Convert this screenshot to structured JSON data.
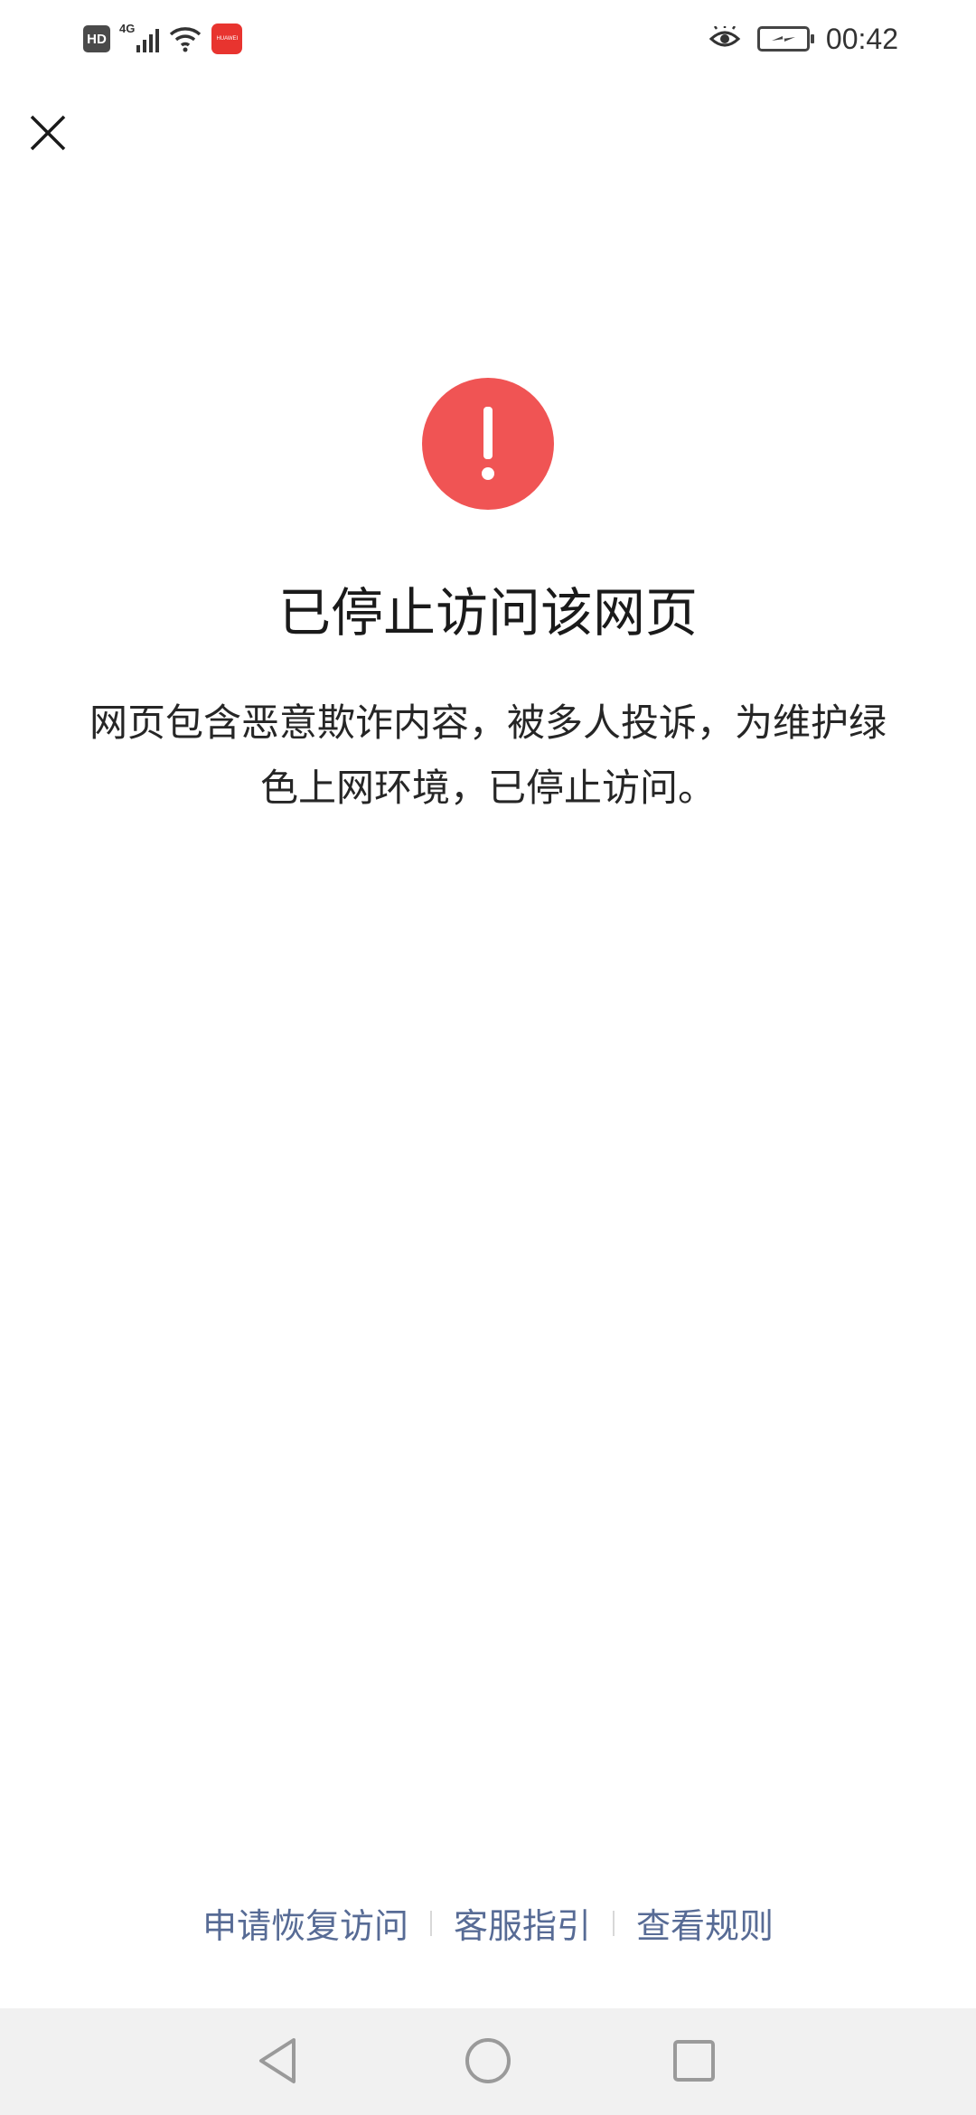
{
  "status_bar": {
    "hd_label": "HD",
    "network_label": "4G",
    "app_icon_label": "HUAWEI",
    "time": "00:42",
    "icons": [
      "hd-icon",
      "signal-icon",
      "wifi-icon",
      "app-store-icon",
      "eye-comfort-icon",
      "battery-charging-icon"
    ]
  },
  "page": {
    "title": "已停止访问该网页",
    "description": "网页包含恶意欺诈内容，被多人投诉，为维护绿色上网环境，已停止访问。",
    "alert_color": "#f05454",
    "close_icon": "close-icon"
  },
  "footer": {
    "links": [
      {
        "label": "申请恢复访问"
      },
      {
        "label": "客服指引"
      },
      {
        "label": "查看规则"
      }
    ],
    "link_color": "#576b95"
  },
  "nav_bar": {
    "buttons": [
      "back-icon",
      "home-icon",
      "recents-icon"
    ]
  }
}
